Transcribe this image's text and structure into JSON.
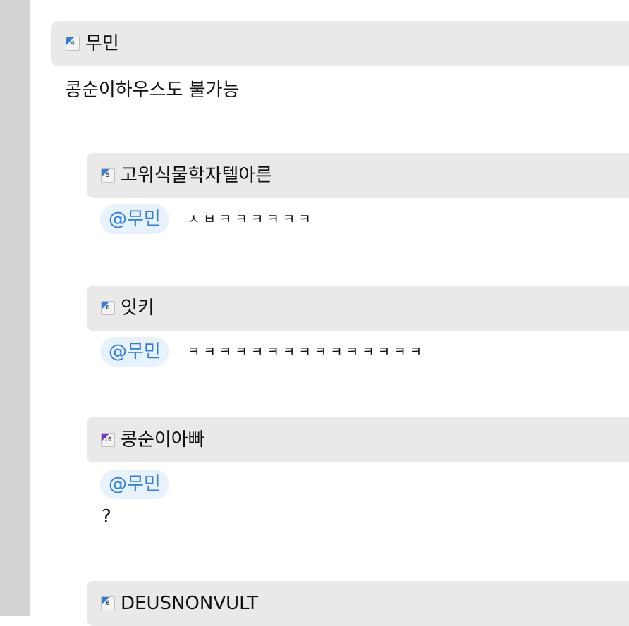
{
  "comments": [
    {
      "level": "4",
      "level_color": "#2f7de1",
      "author": "무민",
      "mention": "",
      "text": "콩순이하우스도 불가능"
    },
    {
      "level": "5",
      "level_color": "#2f7de1",
      "author": "고위식물학자텔아른",
      "mention": "@무민",
      "text": "ㅅㅂㅋㅋㅋㅋㅋㅋ"
    },
    {
      "level": "6",
      "level_color": "#2f7de1",
      "author": "잇키",
      "mention": "@무민",
      "text": "ㅋㅋㅋㅋㅋㅋㅋㅋㅋㅋㅋㅋㅋㅋㅋ"
    },
    {
      "level": "10",
      "level_color": "#7b2fd6",
      "author": "콩순이아빠",
      "mention": "@무민",
      "text": "?"
    },
    {
      "level": "6",
      "level_color": "#2f7de1",
      "author": "DEUSNONVULT",
      "mention": "",
      "text": ""
    }
  ]
}
